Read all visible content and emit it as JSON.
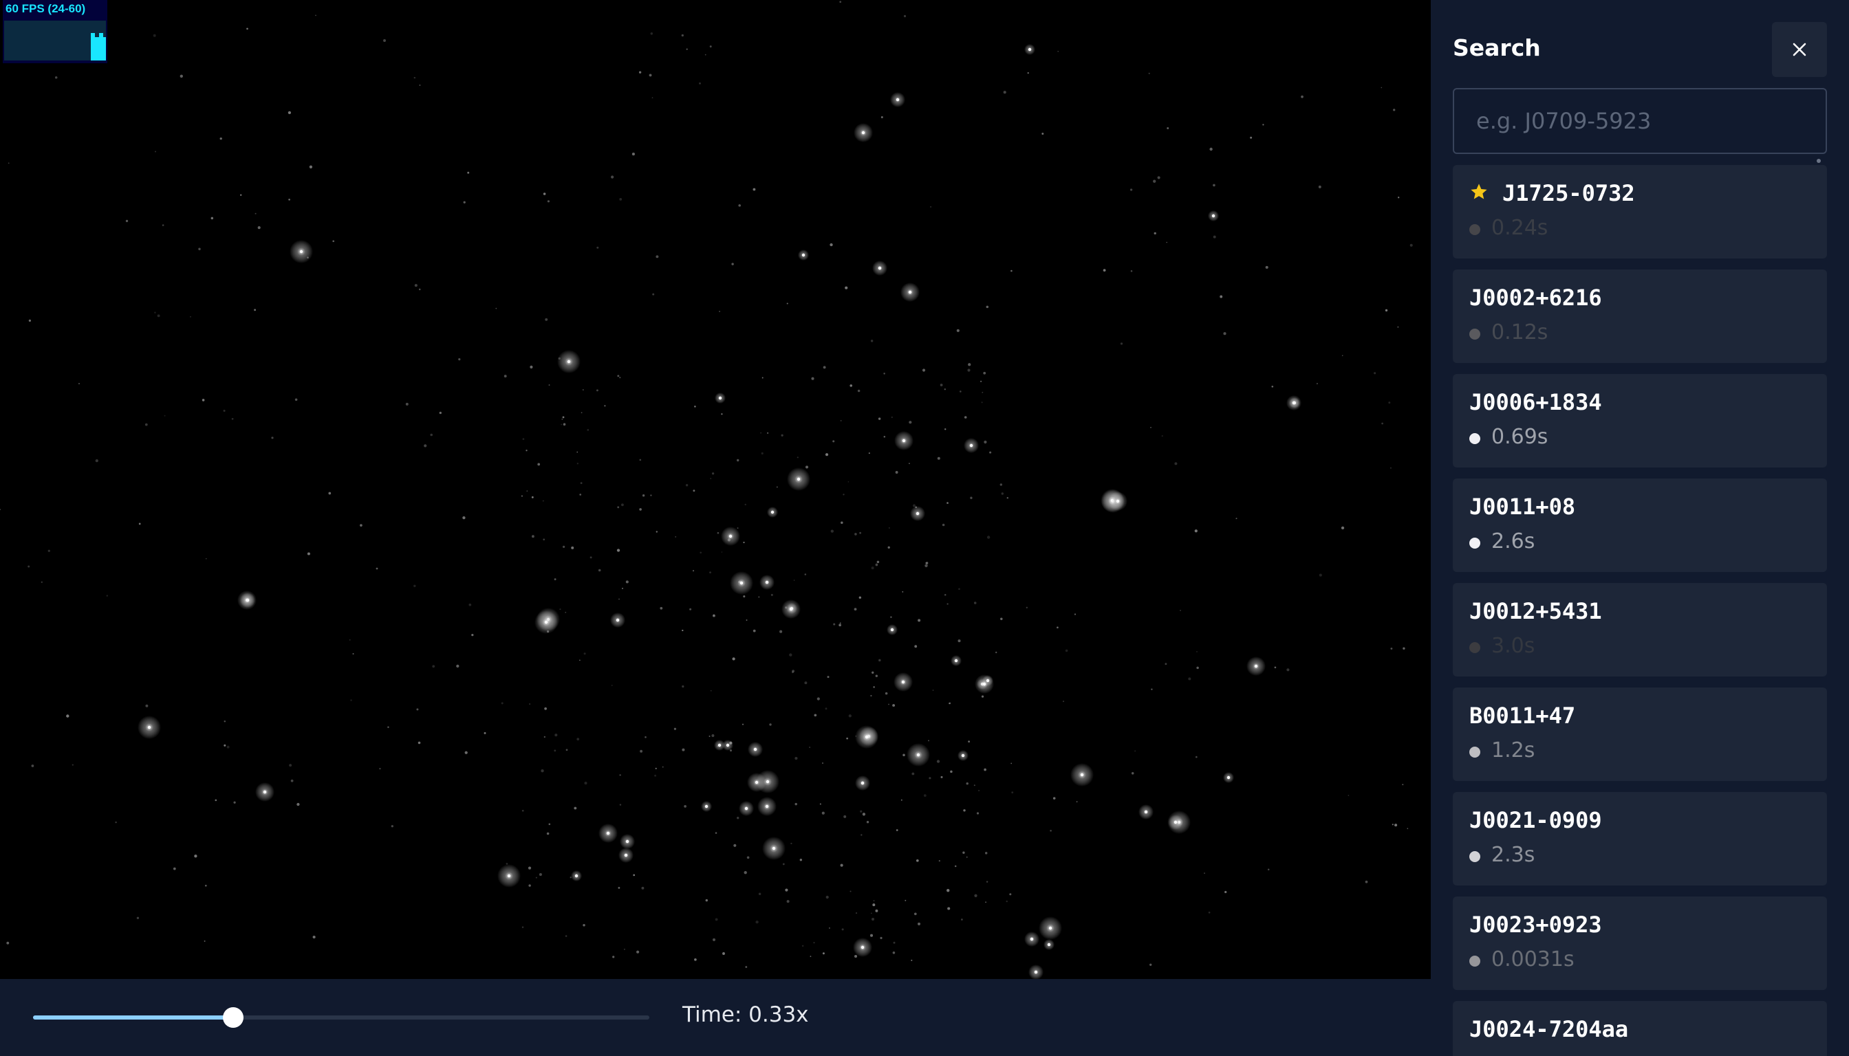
{
  "fps_meter": {
    "label": "60 FPS (24-60)",
    "color": "#19e6ff",
    "recent_fps": [
      24,
      60,
      60
    ]
  },
  "time_control": {
    "label": "Time: 0.33x",
    "slider_fraction": 0.325
  },
  "search_panel": {
    "title": "Search",
    "close_icon": "close-icon",
    "search_placeholder": "e.g. J0709-5923",
    "search_value": "",
    "results": [
      {
        "name": "J1725-0732",
        "period": "0.24s",
        "favorite": true,
        "brightness": 0.15
      },
      {
        "name": "J0002+6216",
        "period": "0.12s",
        "favorite": false,
        "brightness": 0.25
      },
      {
        "name": "J0006+1834",
        "period": "0.69s",
        "favorite": false,
        "brightness": 1.0
      },
      {
        "name": "J0011+08",
        "period": "2.6s",
        "favorite": false,
        "brightness": 1.0
      },
      {
        "name": "J0012+5431",
        "period": "3.0s",
        "favorite": false,
        "brightness": 0.1
      },
      {
        "name": "B0011+47",
        "period": "1.2s",
        "favorite": false,
        "brightness": 0.75
      },
      {
        "name": "J0021-0909",
        "period": "2.3s",
        "favorite": false,
        "brightness": 0.85
      },
      {
        "name": "J0023+0923",
        "period": "0.0031s",
        "favorite": false,
        "brightness": 0.55
      },
      {
        "name": "J0024-7204aa",
        "period": "",
        "favorite": false,
        "brightness": 0.5
      }
    ]
  },
  "colors": {
    "background": "#000000",
    "panel": "#111a2e",
    "card": "#1d2638",
    "accent": "#8ccfff",
    "favorite_star": "#f5c518"
  }
}
